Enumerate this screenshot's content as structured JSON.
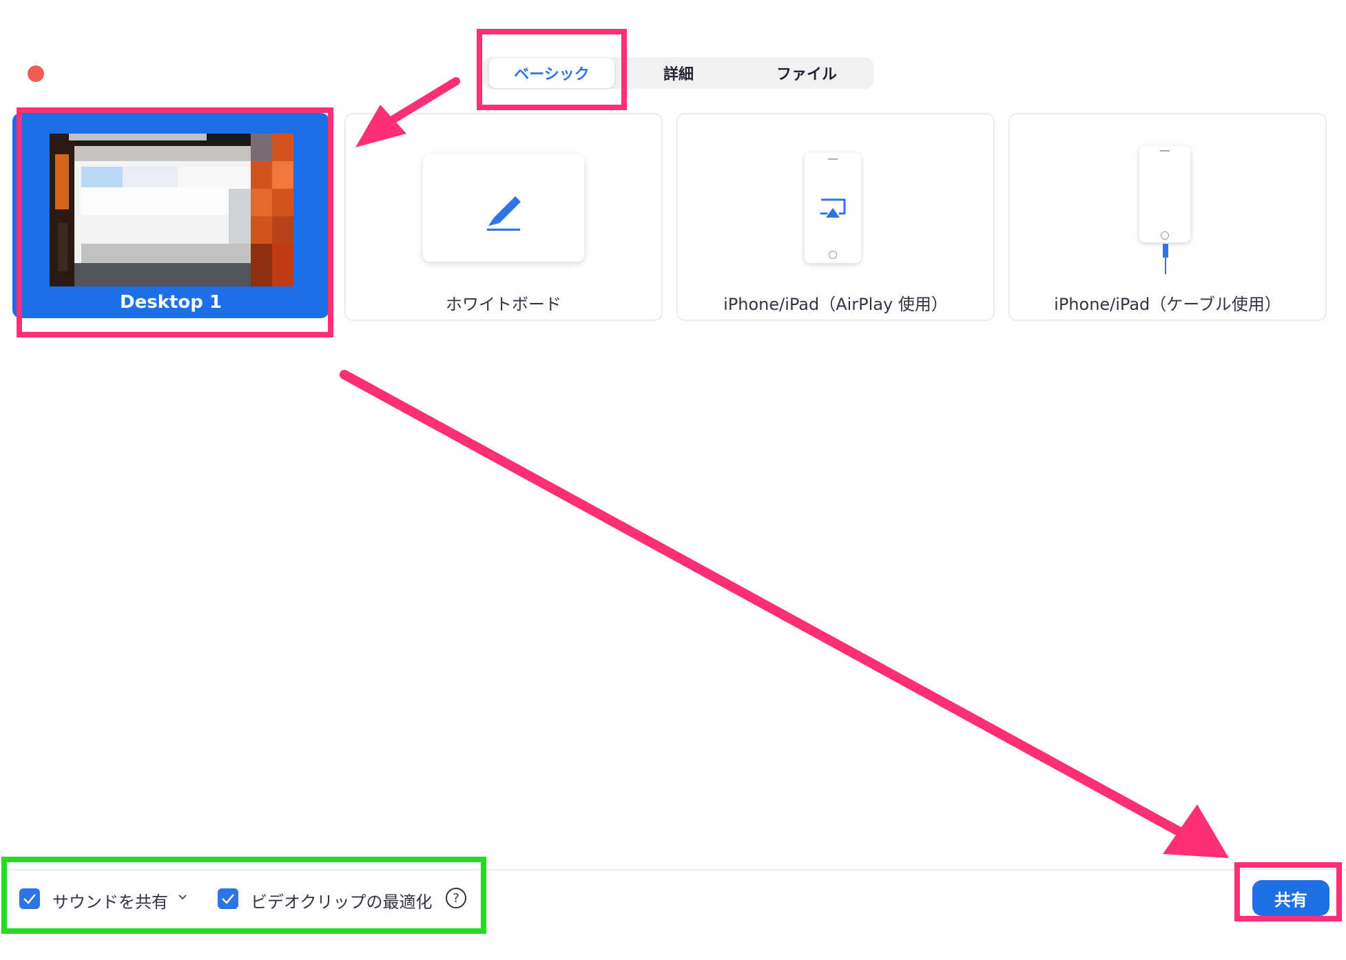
{
  "tabs": [
    {
      "label": "ベーシック",
      "active": true
    },
    {
      "label": "詳細",
      "active": false
    },
    {
      "label": "ファイル",
      "active": false
    }
  ],
  "cards": {
    "desktop": {
      "label": "Desktop 1",
      "selected": true
    },
    "whiteboard": {
      "label": "ホワイトボード"
    },
    "airplay": {
      "label": "iPhone/iPad（AirPlay 使用）"
    },
    "cable": {
      "label": "iPhone/iPad（ケーブル使用）"
    }
  },
  "footer": {
    "share_sound_label": "サウンドを共有",
    "share_sound_checked": true,
    "optimize_video_label": "ビデオクリップの最適化",
    "optimize_video_checked": true,
    "share_button_label": "共有"
  },
  "colors": {
    "accent": "#1f6fe7",
    "annotation_pink": "#ff2f77",
    "annotation_green": "#22dd22",
    "close_dot": "#ee5c55"
  },
  "icons": [
    "close-dot",
    "marker-pen-icon",
    "airplay-icon",
    "phone-icon",
    "lightning-cable-icon",
    "check-icon",
    "chevron-down-icon",
    "help-icon"
  ]
}
